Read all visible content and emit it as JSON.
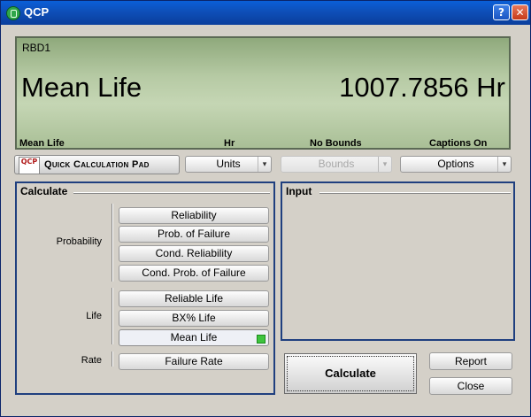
{
  "window": {
    "title": "QCP",
    "help_label": "?",
    "close_label": "✕",
    "icon": "app-icon"
  },
  "display": {
    "name": "RBD1",
    "measure": "Mean Life",
    "value": "1007.7856 Hr",
    "status": {
      "measure": "Mean Life",
      "unit": "Hr",
      "bounds": "No Bounds",
      "captions": "Captions On"
    }
  },
  "toolbar": {
    "qcp_logo": "QCP",
    "qcp_label": "Quick Calculation Pad",
    "units": {
      "label": "Units",
      "enabled": true
    },
    "bounds": {
      "label": "Bounds",
      "enabled": false
    },
    "options": {
      "label": "Options",
      "enabled": true
    },
    "arrow": "▾"
  },
  "calculate": {
    "title": "Calculate",
    "groups": [
      {
        "label": "Probability",
        "buttons": [
          "Reliability",
          "Prob. of Failure",
          "Cond. Reliability",
          "Cond. Prob. of Failure"
        ]
      },
      {
        "label": "Life",
        "buttons": [
          "Reliable Life",
          "BX% Life",
          "Mean Life"
        ]
      },
      {
        "label": "Rate",
        "buttons": [
          "Failure Rate"
        ]
      }
    ],
    "selected": "Mean Life"
  },
  "input": {
    "title": "Input"
  },
  "actions": {
    "calculate": "Calculate",
    "report": "Report",
    "close": "Close"
  },
  "colors": {
    "title_bar": "#0e4fb8",
    "panel_border": "#1f3f7f",
    "lcd": "#b6caa4",
    "selected_marker": "#3ec43e"
  }
}
